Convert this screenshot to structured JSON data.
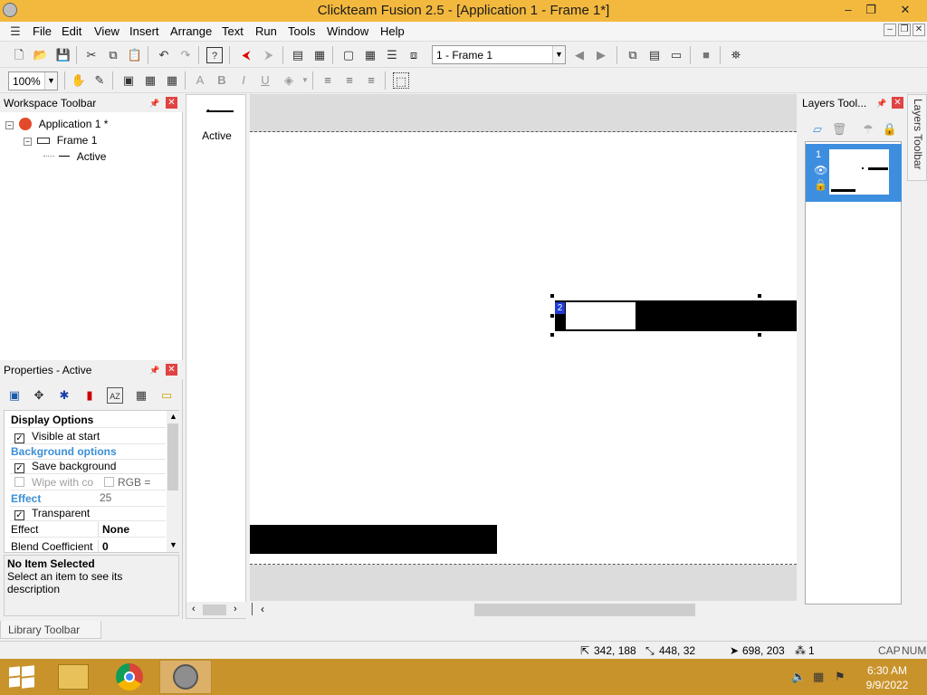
{
  "window": {
    "title": "Clickteam Fusion 2.5 - [Application 1 - Frame 1*]",
    "controls": [
      "–",
      "❐",
      "✕"
    ]
  },
  "menu": [
    "File",
    "Edit",
    "View",
    "Insert",
    "Arrange",
    "Text",
    "Run",
    "Tools",
    "Window",
    "Help"
  ],
  "toolbar": {
    "frame_select": "1 - Frame 1",
    "zoom": "100%"
  },
  "workspace": {
    "title": "Workspace Toolbar",
    "tree": [
      {
        "label": "Application 1 *",
        "level": 0
      },
      {
        "label": "Frame 1",
        "level": 1
      },
      {
        "label": "Active",
        "level": 2
      }
    ]
  },
  "object_list": {
    "item_label": "Active"
  },
  "properties": {
    "title": "Properties - Active",
    "rows": {
      "display_options": "Display Options",
      "visible_at_start": "Visible at start",
      "background_options": "Background options",
      "save_background": "Save background",
      "wipe_with": "Wipe with co",
      "rgb": "RGB = 25",
      "effect_header": "Effect",
      "transparent": "Transparent",
      "effect_label": "Effect",
      "effect_value": "None",
      "blend_label": "Blend Coefficient",
      "blend_value": "0"
    },
    "description_title": "No Item Selected",
    "description_text": "Select an item to see its description"
  },
  "layers": {
    "title": "Layers Tool...",
    "side_tab": "Layers Toolbar",
    "layer_number": "1"
  },
  "editor": {
    "object_badge": "2"
  },
  "library_tab": "Library Toolbar",
  "status": {
    "position": "342, 188",
    "size": "448, 32",
    "mouse": "698, 203",
    "count": "1",
    "caps": "CAP",
    "num": "NUM"
  },
  "taskbar": {
    "time": "6:30 AM",
    "date": "9/9/2022"
  },
  "colors": {
    "titlebar": "#f3b93f",
    "taskbar": "#c9932c",
    "layer_selected": "#3e8ee0",
    "section_header": "#3b8fd6"
  }
}
